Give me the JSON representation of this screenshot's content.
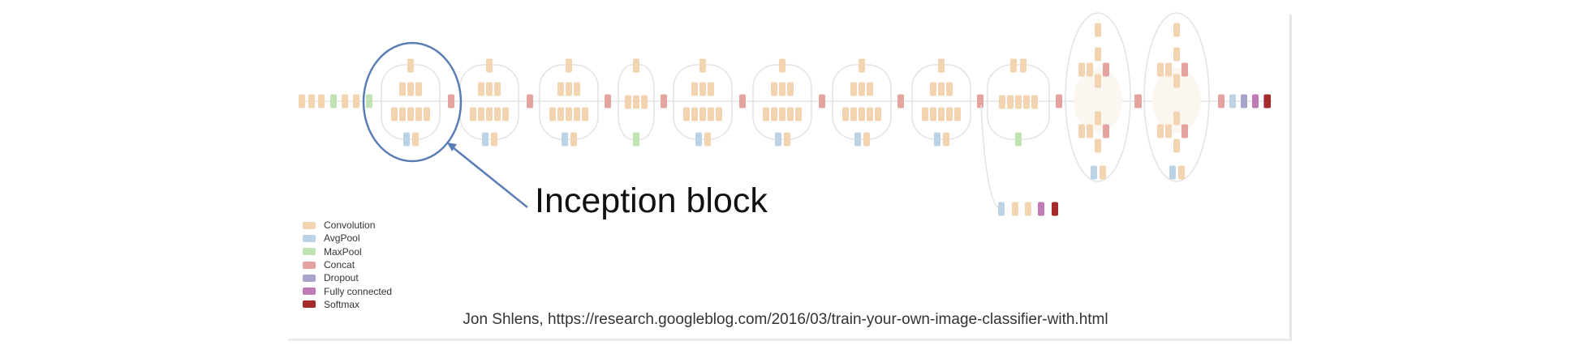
{
  "diagram": {
    "callout_label": "Inception block",
    "caption": "Jon Shlens, https://research.googleblog.com/2016/03/train-your-own-image-classifier-with.html",
    "legend": [
      {
        "label": "Convolution",
        "color": "#f2d4b0"
      },
      {
        "label": "AvgPool",
        "color": "#bcd3e6"
      },
      {
        "label": "MaxPool",
        "color": "#bfe3b3"
      },
      {
        "label": "Concat",
        "color": "#e4a39f"
      },
      {
        "label": "Dropout",
        "color": "#a6a3cc"
      },
      {
        "label": "Fully connected",
        "color": "#c07ab5"
      },
      {
        "label": "Softmax",
        "color": "#a52a2a"
      }
    ],
    "highlight_color": "#5b7db5",
    "edge_color": "#e3e3e3"
  }
}
